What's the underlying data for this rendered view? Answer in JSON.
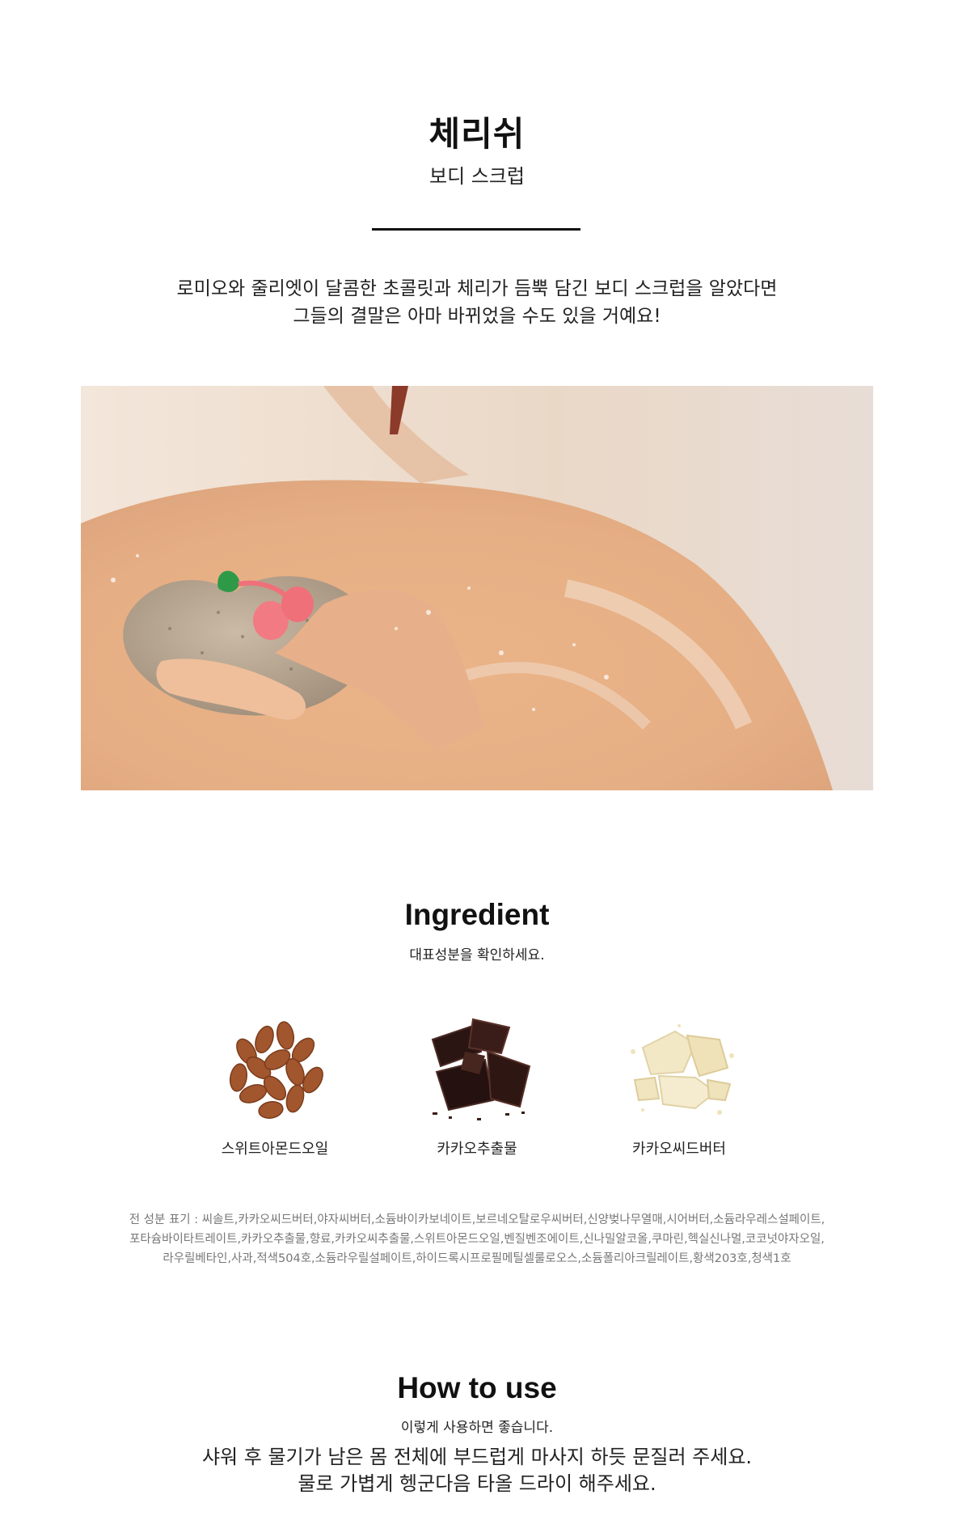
{
  "product": {
    "name": "체리쉬",
    "type": "보디 스크럽"
  },
  "intro": {
    "line1": "로미오와 줄리엣이 달콤한 초콜릿과 체리가 듬뿍 담긴 보디 스크럽을 알았다면",
    "line2": "그들의 결말은 아마 바뀌었을 수도 있을 거예요!"
  },
  "ingredient_section": {
    "heading": "Ingredient",
    "subheading": "대표성분을 확인하세요.",
    "items": [
      {
        "label": "스위트아몬드오일",
        "icon": "almond-icon"
      },
      {
        "label": "카카오추출물",
        "icon": "chocolate-icon"
      },
      {
        "label": "카카오씨드버터",
        "icon": "cocoa-butter-icon"
      }
    ],
    "full_list": {
      "line1": "전 성분 표기 : 씨솔트,카카오씨드버터,야자씨버터,소듐바이카보네이트,보르네오탈로우씨버터,신양벚나무열매,시어버터,소듐라우레스설페이트,",
      "line2": "포타슘바이타트레이트,카카오추출물,향료,카카오씨추출물,스위트아몬드오일,벤질벤조에이트,신나밀알코올,쿠마린,헥실신나멀,코코넛야자오일,",
      "line3": "라우릴베타인,사과,적색504호,소듐라우릴설페이트,하이드록시프로필메틸셀룰로오스,소듐폴리아크릴레이트,황색203호,청색1호"
    }
  },
  "howto_section": {
    "heading": "How to use",
    "subheading": "이렇게 사용하면 좋습니다.",
    "line1": "샤워 후 물기가 남은 몸 전체에 부드럽게 마사지 하듯 문질러 주세요.",
    "line2": "물로 가볍게 헹군다음 타올 드라이 해주세요."
  },
  "colors": {
    "text": "#111111",
    "muted": "#777777",
    "skin": "#e8b48c",
    "cherry": "#f0707a",
    "leaf": "#2e9a48"
  }
}
